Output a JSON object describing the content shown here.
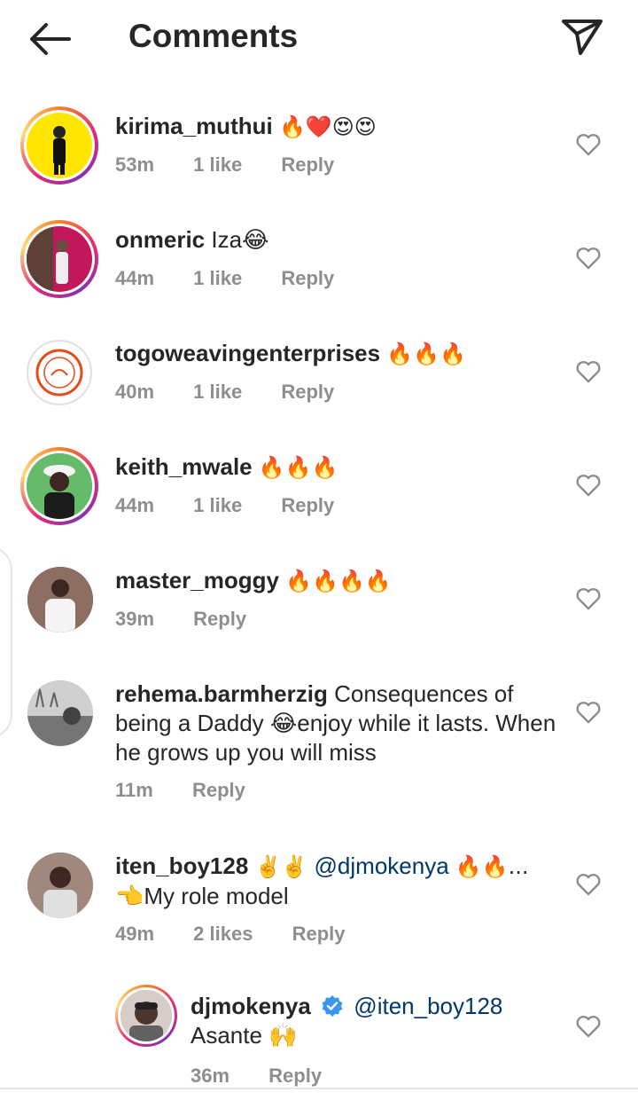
{
  "header": {
    "title": "Comments",
    "back_icon": "arrow-left-icon",
    "share_icon": "paper-plane-icon"
  },
  "comments": [
    {
      "username": "kirima_muthui",
      "text": "🔥❤️😍😍",
      "time": "53m",
      "likes": "1 like",
      "reply": "Reply"
    },
    {
      "username": "onmeric",
      "text": "Iza😂",
      "time": "44m",
      "likes": "1 like",
      "reply": "Reply"
    },
    {
      "username": "togoweavingenterprises",
      "text": "🔥🔥🔥",
      "time": "40m",
      "likes": "1 like",
      "reply": "Reply"
    },
    {
      "username": "keith_mwale",
      "text": "🔥🔥🔥",
      "time": "44m",
      "likes": "1 like",
      "reply": "Reply"
    },
    {
      "username": "master_moggy",
      "text": "🔥🔥🔥🔥",
      "time": "39m",
      "likes": "",
      "reply": "Reply"
    },
    {
      "username": "rehema.barmherzig",
      "text": "Consequences of being a Daddy 😂enjoy while it lasts. When he grows up you will miss",
      "time": "11m",
      "likes": "",
      "reply": "Reply"
    },
    {
      "username": "iten_boy128",
      "emojis_before": "✌️✌️",
      "mention": "@djmokenya",
      "emojis_after": "🔥🔥...",
      "text_line2": "👈My role model",
      "time": "49m",
      "likes": "2 likes",
      "reply": "Reply"
    }
  ],
  "reply": {
    "username": "djmokenya",
    "verified": true,
    "mention": "@iten_boy128",
    "text": "Asante 🙌",
    "time": "36m",
    "reply": "Reply"
  },
  "colors": {
    "text": "#262626",
    "meta": "#8e8e8e",
    "mention": "#00376b",
    "verified": "#3897f0"
  }
}
